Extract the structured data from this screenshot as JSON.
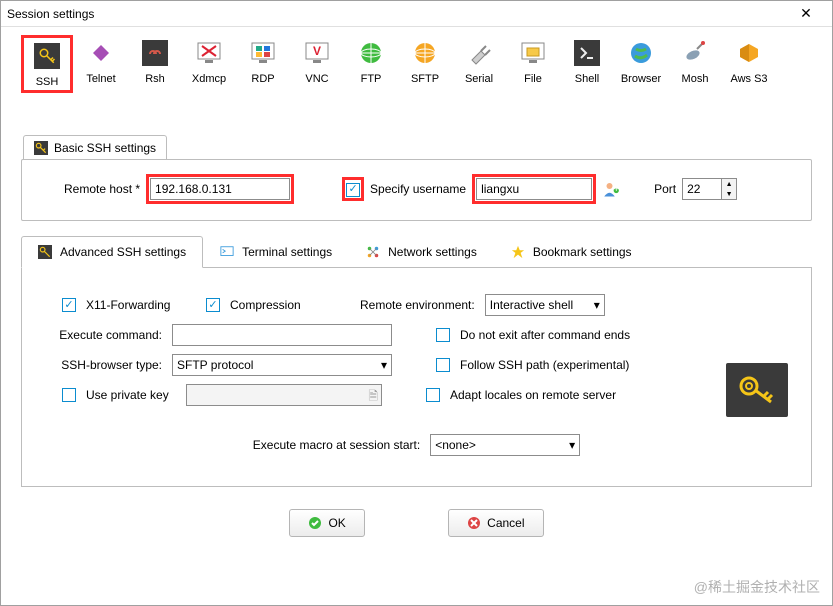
{
  "window": {
    "title": "Session settings",
    "close": "✕"
  },
  "protocols": [
    {
      "name": "SSH",
      "selected": true,
      "icon": "key"
    },
    {
      "name": "Telnet",
      "selected": false,
      "icon": "diamond"
    },
    {
      "name": "Rsh",
      "selected": false,
      "icon": "chain"
    },
    {
      "name": "Xdmcp",
      "selected": false,
      "icon": "xmon"
    },
    {
      "name": "RDP",
      "selected": false,
      "icon": "rdp"
    },
    {
      "name": "VNC",
      "selected": false,
      "icon": "vnc"
    },
    {
      "name": "FTP",
      "selected": false,
      "icon": "globe-green"
    },
    {
      "name": "SFTP",
      "selected": false,
      "icon": "globe-orange"
    },
    {
      "name": "Serial",
      "selected": false,
      "icon": "plug"
    },
    {
      "name": "File",
      "selected": false,
      "icon": "folder"
    },
    {
      "name": "Shell",
      "selected": false,
      "icon": "term"
    },
    {
      "name": "Browser",
      "selected": false,
      "icon": "globe-blue"
    },
    {
      "name": "Mosh",
      "selected": false,
      "icon": "sat"
    },
    {
      "name": "Aws S3",
      "selected": false,
      "icon": "aws"
    }
  ],
  "basic": {
    "tab_label": "Basic SSH settings",
    "remote_host_label": "Remote host *",
    "remote_host_value": "192.168.0.131",
    "specify_username_checked": true,
    "specify_username_label": "Specify username",
    "username_value": "liangxu",
    "port_label": "Port",
    "port_value": "22"
  },
  "subtabs": {
    "advanced": "Advanced SSH settings",
    "terminal": "Terminal settings",
    "network": "Network settings",
    "bookmark": "Bookmark settings"
  },
  "advanced": {
    "x11_checked": true,
    "x11_label": "X11-Forwarding",
    "compression_checked": true,
    "compression_label": "Compression",
    "remote_env_label": "Remote environment:",
    "remote_env_value": "Interactive shell",
    "execute_cmd_label": "Execute command:",
    "execute_cmd_value": "",
    "no_exit_checked": false,
    "no_exit_label": "Do not exit after command ends",
    "browser_type_label": "SSH-browser type:",
    "browser_type_value": "SFTP protocol",
    "follow_path_checked": false,
    "follow_path_label": "Follow SSH path (experimental)",
    "private_key_checked": false,
    "private_key_label": "Use private key",
    "private_key_value": "",
    "adapt_locales_checked": false,
    "adapt_locales_label": "Adapt locales on remote server",
    "macro_label": "Execute macro at session start:",
    "macro_value": "<none>"
  },
  "buttons": {
    "ok": "OK",
    "cancel": "Cancel"
  },
  "watermark": "@稀土掘金技术社区"
}
